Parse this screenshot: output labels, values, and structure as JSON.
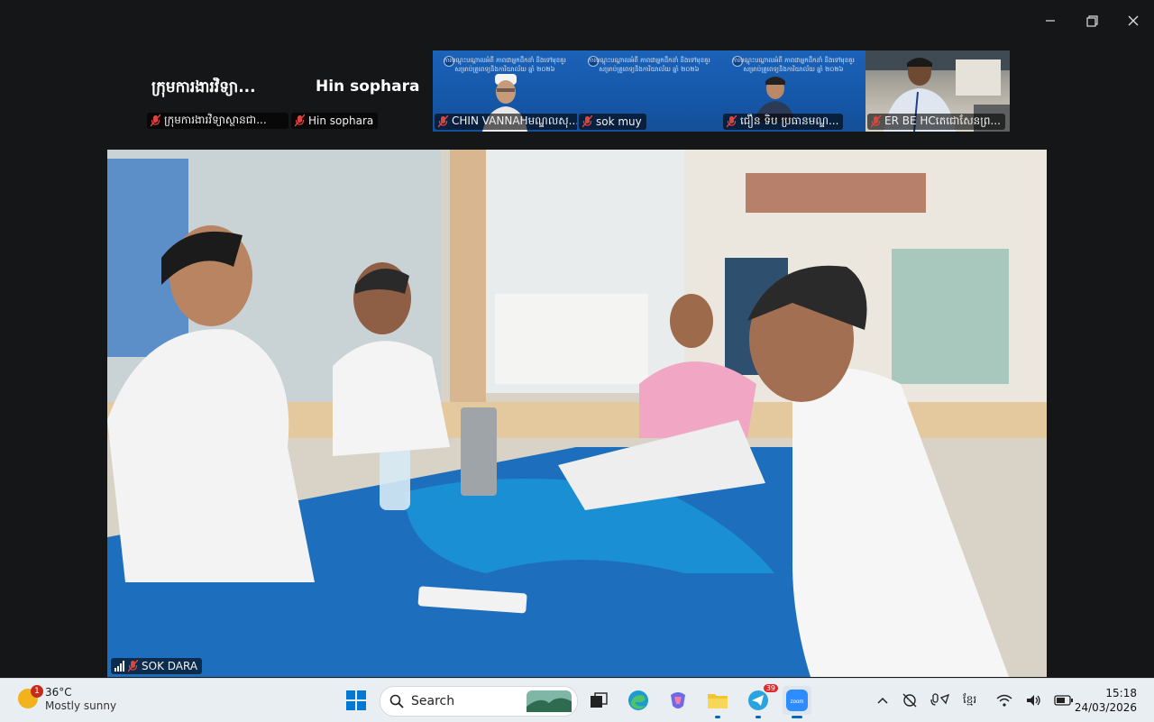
{
  "window": {
    "controls": [
      "minimize",
      "restore",
      "close"
    ]
  },
  "participants_strip": {
    "tile1": {
      "name": "ក្រុមការងារវិទ្យា...",
      "label": "ក្រុមការងារវិទ្យាស្ថានជា..."
    },
    "tile2": {
      "name": "Hin sophara",
      "label": "Hin sophara"
    },
    "video_tiles": [
      {
        "label": "CHIN VANNAHមណ្ឌលសុ..."
      },
      {
        "label": "sok muy"
      },
      {
        "label": "ជឿន ទិប ប្រធានមណ្ឌ..."
      },
      {
        "label": "ER BE HCតេជោសែនព្រ..."
      }
    ],
    "slide_text": "ការបណ្តុះបណ្តាលអំពី ភាពជាអ្នកដឹកនាំ និងទៅមុខគួរ សម្រាប់គ្រូពេទ្យនិងការិយាល័យ ឆ្នាំ ២០២៦"
  },
  "main_video": {
    "speaker_label": "SOK DARA"
  },
  "taskbar": {
    "weather": {
      "temp": "36°C",
      "condition": "Mostly sunny",
      "badge": "1"
    },
    "search_placeholder": "Search",
    "telegram_badge": "39",
    "language": "ខ្មែរ",
    "time": "15:18",
    "date": "24/03/2026"
  },
  "colors": {
    "background": "#141617",
    "taskbar": "#e9eef3",
    "tile_blue": "#1b62b8",
    "muted_red": "#e0433c"
  }
}
